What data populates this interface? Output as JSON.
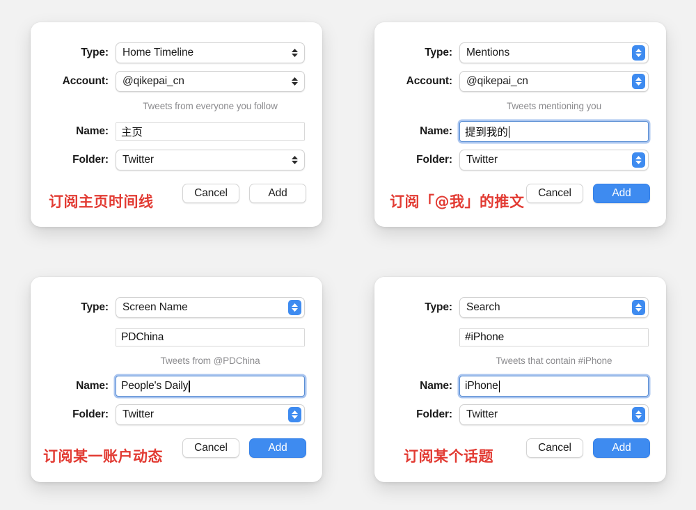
{
  "background_color": "#f2f2f2",
  "accent_color": "#3e8bf0",
  "annotation_color": "#e23b33",
  "labels": {
    "type": "Type:",
    "account": "Account:",
    "name": "Name:",
    "folder": "Folder:"
  },
  "buttons": {
    "cancel": "Cancel",
    "add": "Add"
  },
  "panels": [
    {
      "id": "home-timeline",
      "position": "top-left",
      "window_active": false,
      "type_value": "Home Timeline",
      "account_value": "@qikepai_cn",
      "query_value": null,
      "hint": "Tweets from everyone you follow",
      "name_value": "主页",
      "name_focused": false,
      "folder_value": "Twitter",
      "cancel_label": "Cancel",
      "add_label": "Add",
      "add_primary": false,
      "annotation": "订阅主页时间线"
    },
    {
      "id": "mentions",
      "position": "top-right",
      "window_active": true,
      "type_value": "Mentions",
      "account_value": "@qikepai_cn",
      "query_value": null,
      "hint": "Tweets mentioning you",
      "name_value": "提到我的",
      "name_focused": true,
      "folder_value": "Twitter",
      "cancel_label": "Cancel",
      "add_label": "Add",
      "add_primary": true,
      "annotation": "订阅「@我」的推文"
    },
    {
      "id": "screen-name",
      "position": "bottom-left",
      "window_active": true,
      "type_value": "Screen Name",
      "account_value": null,
      "query_value": "PDChina",
      "hint": "Tweets from @PDChina",
      "name_value": "People's Daily",
      "name_focused": true,
      "folder_value": "Twitter",
      "cancel_label": "Cancel",
      "add_label": "Add",
      "add_primary": true,
      "annotation": "订阅某一账户动态"
    },
    {
      "id": "search",
      "position": "bottom-right",
      "window_active": true,
      "type_value": "Search",
      "account_value": null,
      "query_value": "#iPhone",
      "hint": "Tweets that contain #iPhone",
      "name_value": "iPhone",
      "name_focused": true,
      "folder_value": "Twitter",
      "cancel_label": "Cancel",
      "add_label": "Add",
      "add_primary": true,
      "annotation": "订阅某个话题"
    }
  ]
}
